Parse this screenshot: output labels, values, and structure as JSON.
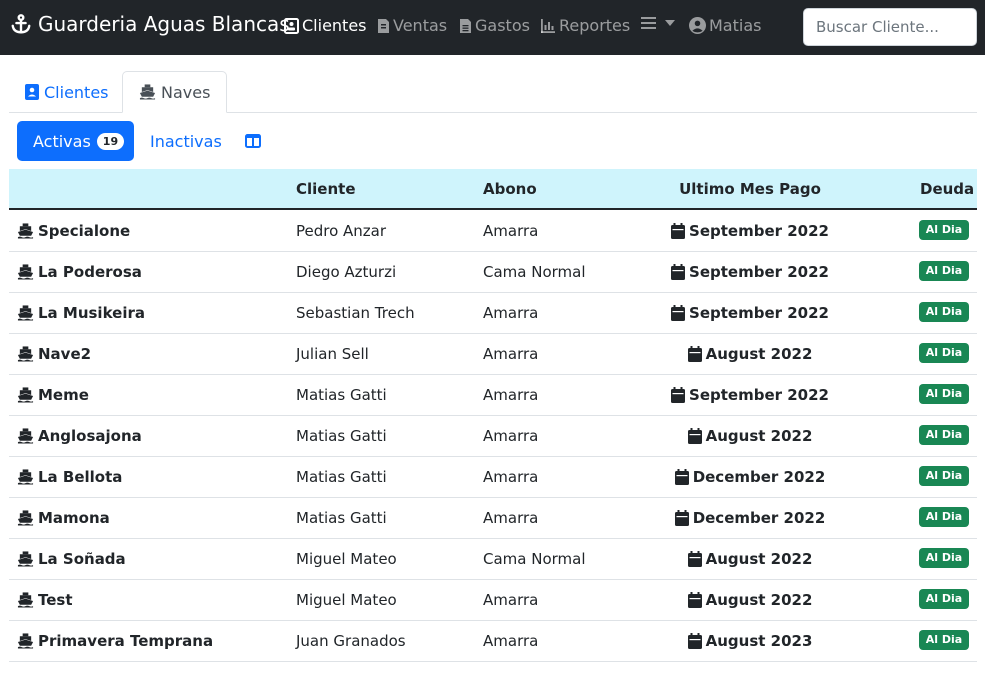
{
  "navbar": {
    "brand": "Guarderia Aguas Blancas",
    "items": [
      {
        "label": "Clientes",
        "icon": "address-card-icon",
        "active": true
      },
      {
        "label": "Ventas",
        "icon": "file-invoice-icon",
        "active": false
      },
      {
        "label": "Gastos",
        "icon": "file-icon",
        "active": false
      },
      {
        "label": "Reportes",
        "icon": "chart-bar-icon",
        "active": false
      }
    ],
    "menu_icon": "hamburger-icon",
    "user": "Matias",
    "search_placeholder": "Buscar Cliente..."
  },
  "tabs": [
    {
      "label": "Clientes",
      "icon": "address-book-icon",
      "active": false
    },
    {
      "label": "Naves",
      "icon": "ship-icon",
      "active": true
    }
  ],
  "filters": {
    "active_label": "Activas",
    "active_count": "19",
    "inactive_label": "Inactivas",
    "columns_icon": "columns-icon"
  },
  "table": {
    "headers": {
      "nave": "",
      "cliente": "Cliente",
      "abono": "Abono",
      "mes": "Ultimo Mes Pago",
      "deuda": "Deuda"
    },
    "rows": [
      {
        "nave": "Specialone",
        "cliente": "Pedro Anzar",
        "abono": "Amarra",
        "mes": "September 2022",
        "deuda": "Al Dia"
      },
      {
        "nave": "La Poderosa",
        "cliente": "Diego Azturzi",
        "abono": "Cama Normal",
        "mes": "September 2022",
        "deuda": "Al Dia"
      },
      {
        "nave": "La Musikeira",
        "cliente": "Sebastian Trech",
        "abono": "Amarra",
        "mes": "September 2022",
        "deuda": "Al Dia"
      },
      {
        "nave": "Nave2",
        "cliente": "Julian Sell",
        "abono": "Amarra",
        "mes": "August 2022",
        "deuda": "Al Dia"
      },
      {
        "nave": "Meme",
        "cliente": "Matias Gatti",
        "abono": "Amarra",
        "mes": "September 2022",
        "deuda": "Al Dia"
      },
      {
        "nave": "Anglosajona",
        "cliente": "Matias Gatti",
        "abono": "Amarra",
        "mes": "August 2022",
        "deuda": "Al Dia"
      },
      {
        "nave": "La Bellota",
        "cliente": "Matias Gatti",
        "abono": "Amarra",
        "mes": "December 2022",
        "deuda": "Al Dia"
      },
      {
        "nave": "Mamona",
        "cliente": "Matias Gatti",
        "abono": "Amarra",
        "mes": "December 2022",
        "deuda": "Al Dia"
      },
      {
        "nave": "La Soñada",
        "cliente": "Miguel Mateo",
        "abono": "Cama Normal",
        "mes": "August 2022",
        "deuda": "Al Dia"
      },
      {
        "nave": "Test",
        "cliente": "Miguel Mateo",
        "abono": "Amarra",
        "mes": "August 2022",
        "deuda": "Al Dia"
      },
      {
        "nave": "Primavera Temprana",
        "cliente": "Juan Granados",
        "abono": "Amarra",
        "mes": "August 2023",
        "deuda": "Al Dia"
      }
    ]
  },
  "colors": {
    "navbar": "#212529",
    "primary": "#0d6efd",
    "header_bg": "#cff4fc",
    "success": "#198754"
  }
}
